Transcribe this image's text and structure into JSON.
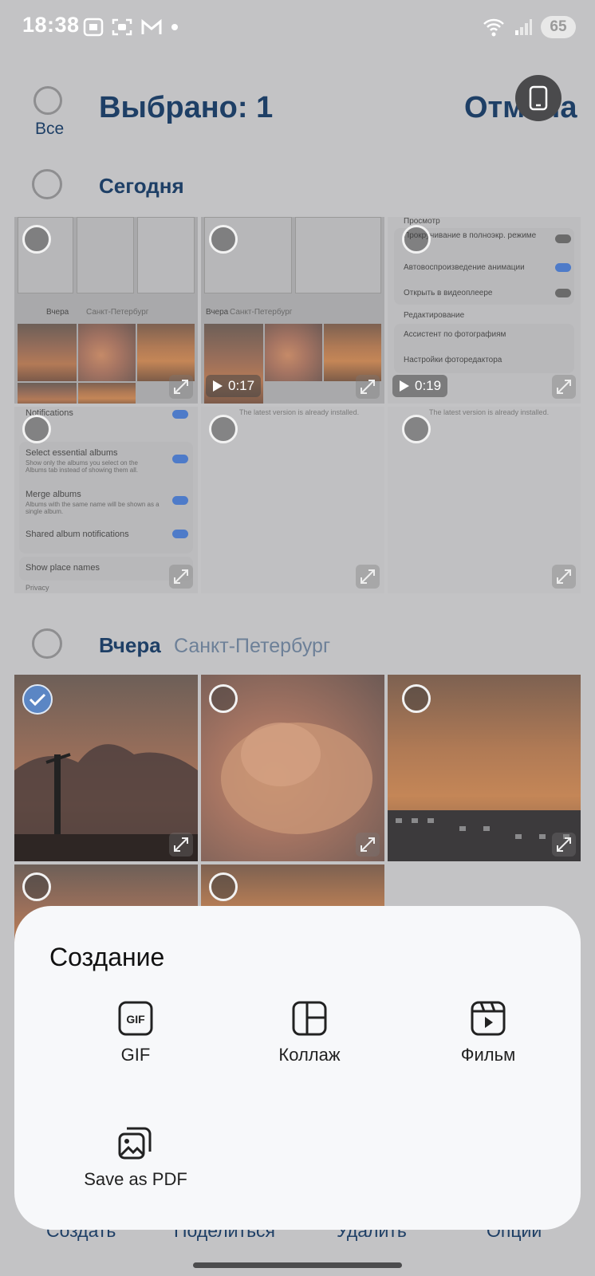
{
  "status_bar": {
    "time": "18:38",
    "battery": "65",
    "icons": [
      "screenshot-icon",
      "screen-record-icon",
      "gmail-icon",
      "dot-icon",
      "wifi-icon",
      "signal-icon"
    ]
  },
  "header": {
    "title": "Выбрано: 1",
    "cancel_label": "Отмена",
    "select_all_label": "Все"
  },
  "sections": {
    "today": {
      "label": "Сегодня"
    },
    "yesterday": {
      "label": "Вчера",
      "location": "Санкт-Петербург"
    }
  },
  "thumbs_today": {
    "t1": {
      "mini_label": "Вчера",
      "mini_location": "Санкт-Петербург"
    },
    "t2": {
      "mini_label": "Вчера",
      "mini_location": "Санкт-Петербург",
      "duration": "0:17"
    },
    "t3": {
      "duration": "0:19",
      "header_view": "Просмотр",
      "row1": "Прокручивание в полноэкр. режиме",
      "row2": "Автовоспроизведение анимации",
      "row3": "Открыть в видеоплеере",
      "header_edit": "Редактирование",
      "row4": "Ассистент по фотографиям",
      "row5": "Настройки фоторедактора"
    },
    "t4": {
      "r1": "Notifications",
      "r2": "Select essential albums",
      "r2_sub": "Show only the albums you select on the Albums tab instead of showing them all.",
      "r3": "Merge albums",
      "r3_sub": "Albums with the same name will be shown as a single album.",
      "r4": "Shared album notifications",
      "r5": "Show place names",
      "r6": "Privacy"
    },
    "t5": {
      "text": "The latest version is already installed."
    },
    "t6": {
      "text": "The latest version is already installed."
    }
  },
  "sheet": {
    "title": "Создание",
    "items": [
      {
        "label": "GIF",
        "icon": "gif-icon"
      },
      {
        "label": "Коллаж",
        "icon": "collage-icon"
      },
      {
        "label": "Фильм",
        "icon": "movie-icon"
      },
      {
        "label": "Save as PDF",
        "icon": "pdf-images-icon"
      }
    ]
  },
  "bottom_bar": {
    "create": "Создать",
    "share": "Поделиться",
    "delete": "Удалить",
    "options": "Опции"
  },
  "colors": {
    "accent": "#1e3f66",
    "selected_check": "#5b86c4",
    "sheet_bg": "#f7f8fa"
  }
}
